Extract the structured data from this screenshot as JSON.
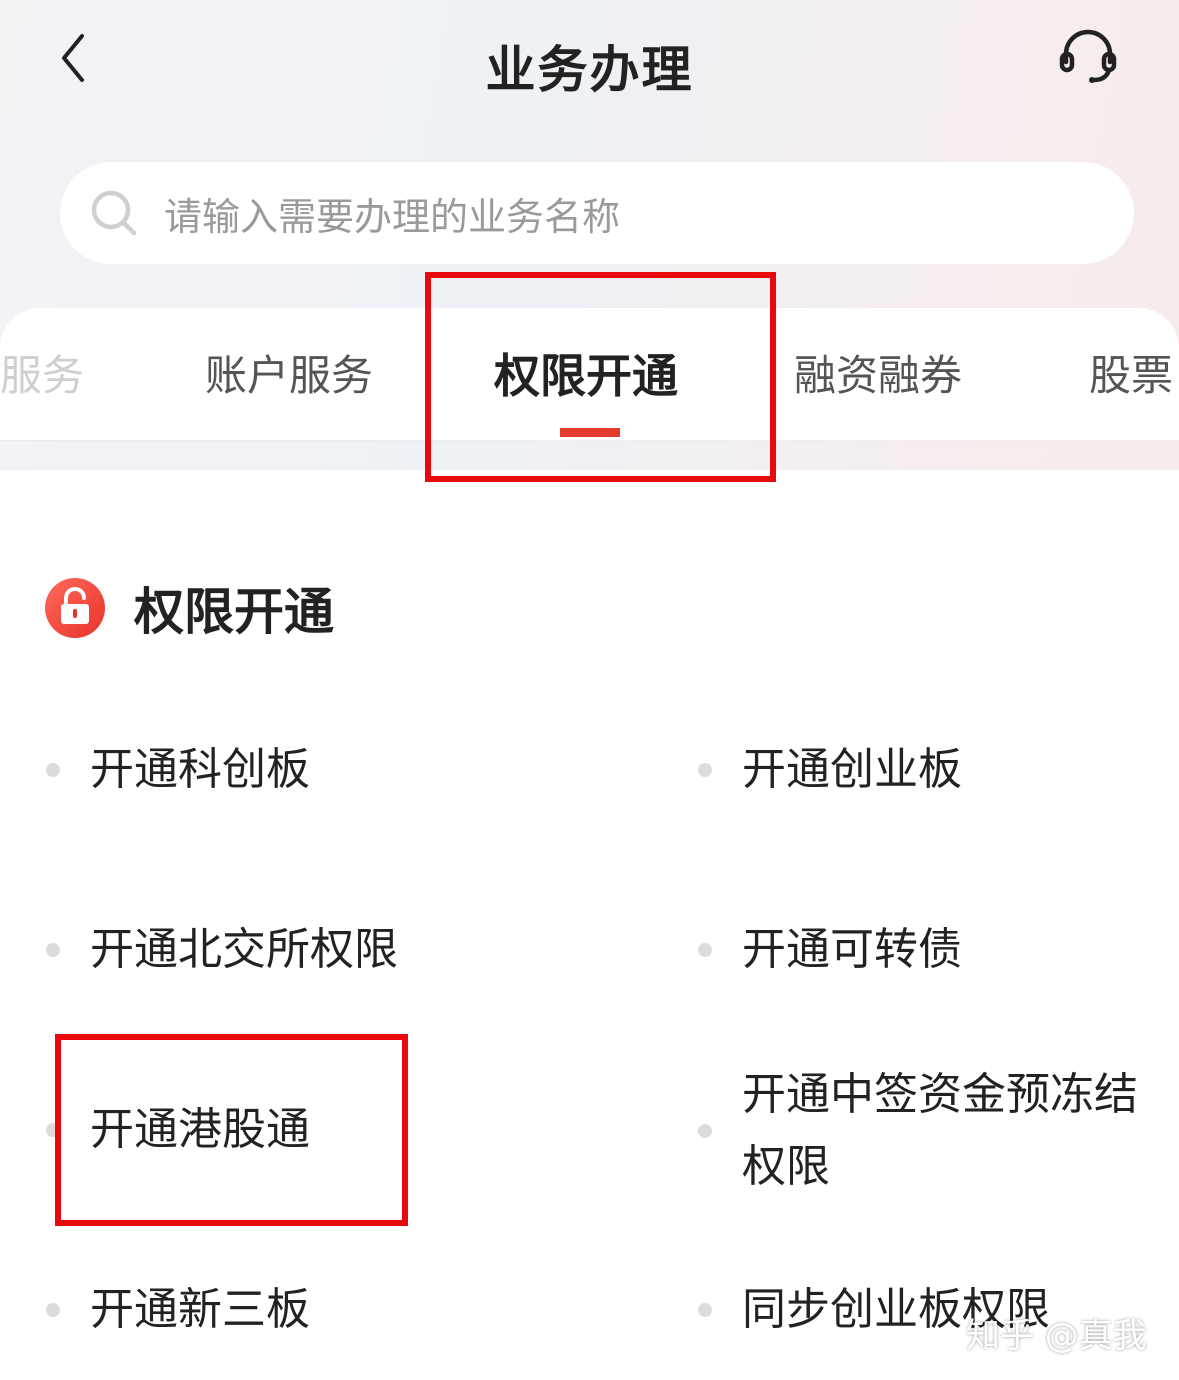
{
  "header": {
    "title": "业务办理",
    "back_icon": "chevron-left-icon",
    "support_icon": "headset-icon"
  },
  "search": {
    "placeholder": "请输入需要办理的业务名称",
    "icon": "search-icon"
  },
  "tabs": [
    {
      "label": "服务",
      "active": false
    },
    {
      "label": "账户服务",
      "active": false
    },
    {
      "label": "权限开通",
      "active": true
    },
    {
      "label": "融资融券",
      "active": false
    },
    {
      "label": "股票",
      "active": false
    }
  ],
  "section": {
    "title": "权限开通",
    "icon": "unlock-icon",
    "items": [
      {
        "label": "开通科创板"
      },
      {
        "label": "开通创业板"
      },
      {
        "label": "开通北交所权限"
      },
      {
        "label": "开通可转债"
      },
      {
        "label": "开通港股通"
      },
      {
        "label": "开通中签资金预冻结权限"
      },
      {
        "label": "开通新三板"
      },
      {
        "label": "同步创业板权限"
      }
    ]
  },
  "watermark": "知乎 @真我",
  "colors": {
    "accent": "#e53a2f",
    "annotation_box": "#e8090f",
    "bullet": "#dcdcdc"
  }
}
